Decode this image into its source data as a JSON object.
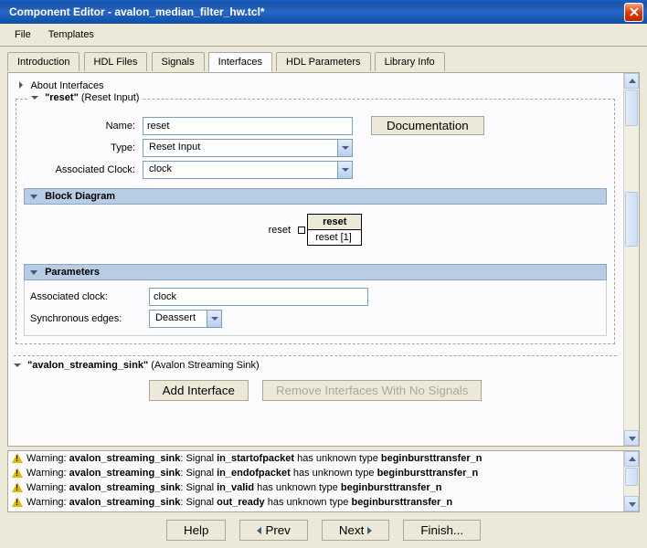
{
  "title": "Component Editor - avalon_median_filter_hw.tcl*",
  "menu": {
    "file": "File",
    "templates": "Templates"
  },
  "tabs": {
    "introduction": "Introduction",
    "hdl_files": "HDL Files",
    "signals": "Signals",
    "interfaces": "Interfaces",
    "hdl_parameters": "HDL Parameters",
    "library_info": "Library Info"
  },
  "about": "About Interfaces",
  "group": {
    "legend_quoted": "\"reset\"",
    "legend_type": "(Reset Input)",
    "fields": {
      "name_label": "Name:",
      "name_value": "reset",
      "type_label": "Type:",
      "type_value": "Reset Input",
      "clock_label": "Associated Clock:",
      "clock_value": "clock"
    },
    "doc_button": "Documentation"
  },
  "block_diagram": {
    "title": "Block Diagram",
    "box_header": "reset",
    "port_label": "reset",
    "port_text": "reset [1]"
  },
  "parameters": {
    "title": "Parameters",
    "assoc_clock_label": "Associated clock:",
    "assoc_clock_value": "clock",
    "sync_edges_label": "Synchronous edges:",
    "sync_edges_value": "Deassert"
  },
  "next_section": {
    "legend_quoted": "\"avalon_streaming_sink\"",
    "legend_type": "(Avalon Streaming Sink)"
  },
  "buttons": {
    "add_interface": "Add Interface",
    "remove_no_signals": "Remove Interfaces With No Signals"
  },
  "warnings": [
    {
      "prefix": "Warning: ",
      "iface": "avalon_streaming_sink",
      "mid1": ": Signal ",
      "sig": "in_startofpacket",
      "mid2": " has unknown type ",
      "type": "beginbursttransfer_n"
    },
    {
      "prefix": "Warning: ",
      "iface": "avalon_streaming_sink",
      "mid1": ": Signal ",
      "sig": "in_endofpacket",
      "mid2": " has unknown type ",
      "type": "beginbursttransfer_n"
    },
    {
      "prefix": "Warning: ",
      "iface": "avalon_streaming_sink",
      "mid1": ": Signal ",
      "sig": "in_valid",
      "mid2": " has unknown type ",
      "type": "beginbursttransfer_n"
    },
    {
      "prefix": "Warning: ",
      "iface": "avalon_streaming_sink",
      "mid1": ": Signal ",
      "sig": "out_ready",
      "mid2": " has unknown type ",
      "type": "beginbursttransfer_n"
    }
  ],
  "bottom": {
    "help": "Help",
    "prev": "Prev",
    "next": "Next",
    "finish": "Finish..."
  }
}
